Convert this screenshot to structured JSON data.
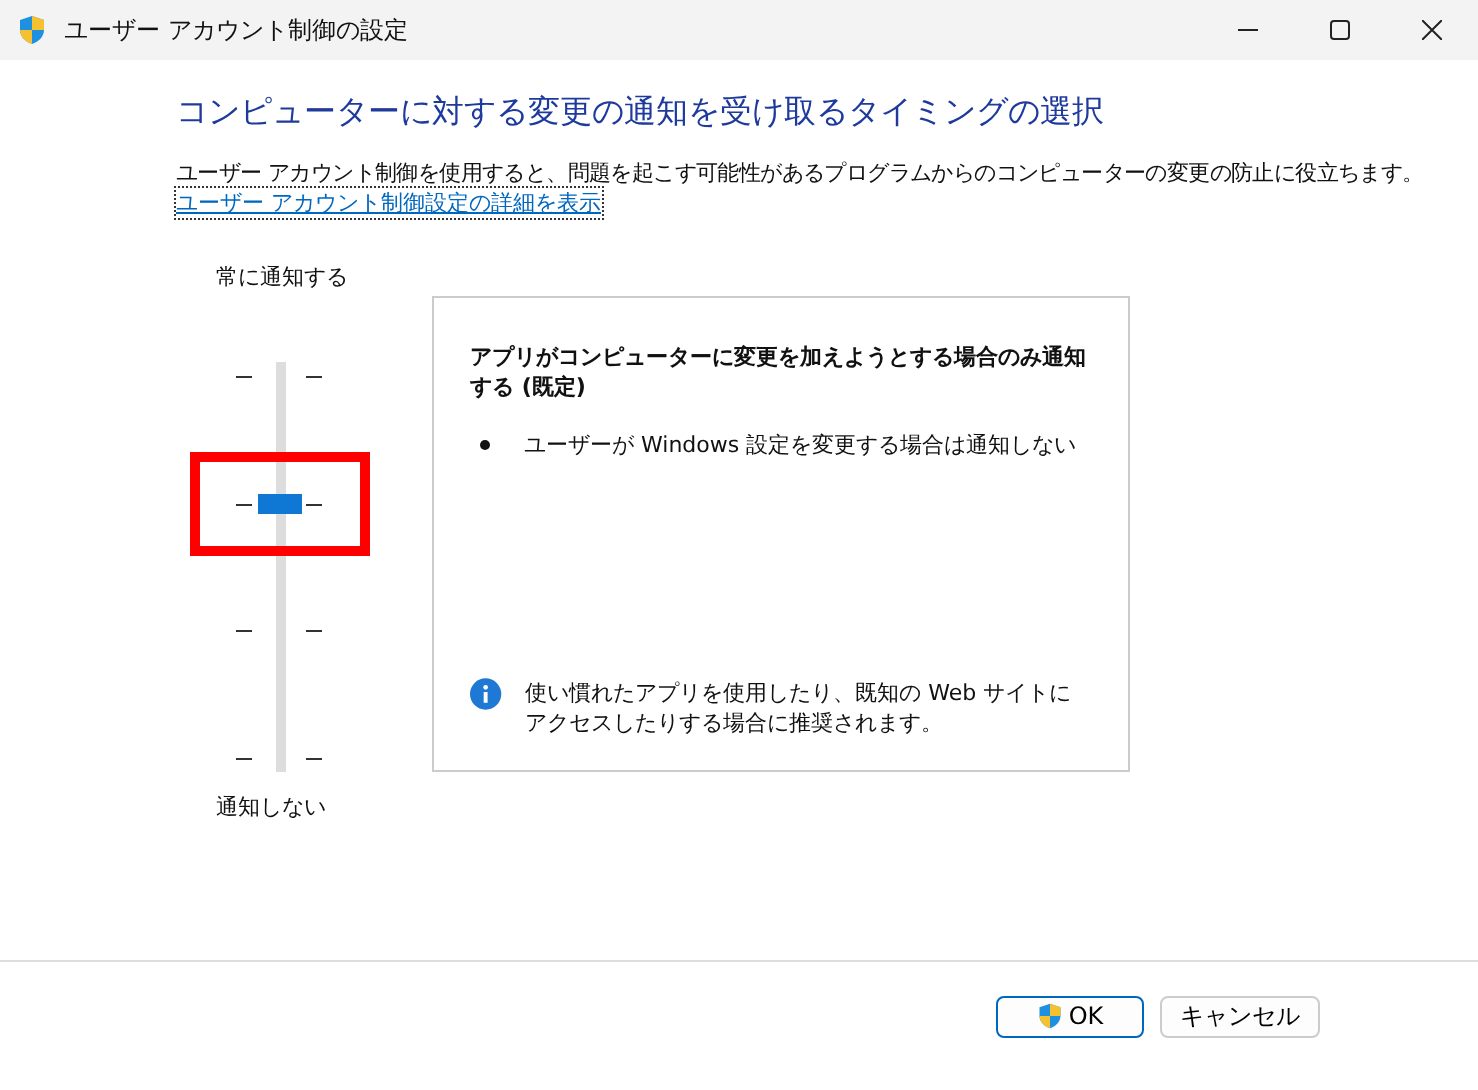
{
  "window": {
    "title": "ユーザー アカウント制御の設定"
  },
  "heading": "コンピューターに対する変更の通知を受け取るタイミングの選択",
  "description": "ユーザー アカウント制御を使用すると、問題を起こす可能性があるプログラムからのコンピューターの変更の防止に役立ちます。",
  "link": "ユーザー アカウント制御設定の詳細を表示",
  "slider": {
    "top_label": "常に通知する",
    "bottom_label": "通知しない",
    "level": 0.667,
    "highlighted": true
  },
  "panel": {
    "title": "アプリがコンピューターに変更を加えようとする場合のみ通知する (既定)",
    "bullets": [
      "ユーザーが Windows 設定を変更する場合は通知しない"
    ],
    "note": "使い慣れたアプリを使用したり、既知の Web サイトにアクセスしたりする場合に推奨されます。"
  },
  "buttons": [
    {
      "label": "OK",
      "kind": "default"
    },
    {
      "label": "キャンセル",
      "kind": "normal"
    }
  ]
}
